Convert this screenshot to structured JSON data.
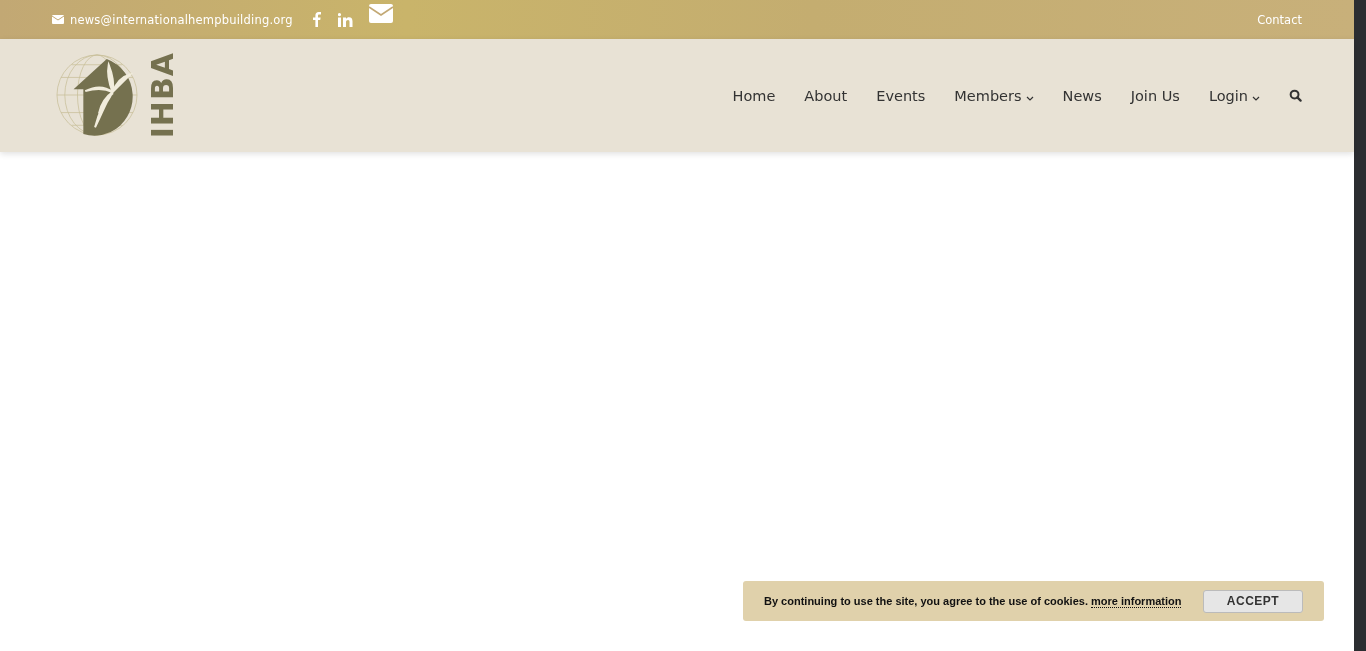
{
  "top_bar": {
    "email": "news@internationalhempbuilding.org",
    "contact_link": "Contact"
  },
  "logo": {
    "text": "IHBA"
  },
  "nav": [
    {
      "label": "Home",
      "dropdown": false
    },
    {
      "label": "About",
      "dropdown": false
    },
    {
      "label": "Events",
      "dropdown": false
    },
    {
      "label": "Members",
      "dropdown": true
    },
    {
      "label": "News",
      "dropdown": false
    },
    {
      "label": "Join Us",
      "dropdown": false
    },
    {
      "label": "Login",
      "dropdown": true
    }
  ],
  "cookie_notice": {
    "message": "By continuing to use the site, you agree to the use of cookies.",
    "link": "more information",
    "button": "ACCEPT"
  }
}
